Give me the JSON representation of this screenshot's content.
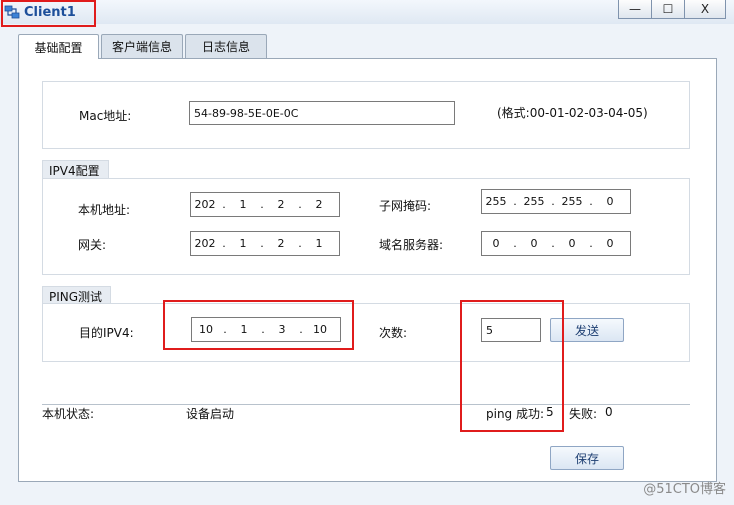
{
  "window": {
    "title": "Client1",
    "controls": {
      "minimize": "—",
      "maximize": "☐",
      "close": "X"
    }
  },
  "tabs": [
    {
      "label": "基础配置",
      "active": true
    },
    {
      "label": "客户端信息",
      "active": false
    },
    {
      "label": "日志信息",
      "active": false
    }
  ],
  "mac": {
    "label": "Mac地址:",
    "value": "54-89-98-5E-0E-0C",
    "format_hint": "(格式:00-01-02-03-04-05)"
  },
  "ipv4": {
    "legend": "IPV4配置",
    "local_ip_label": "本机地址:",
    "local_ip": [
      "202",
      "1",
      "2",
      "2"
    ],
    "subnet_label": "子网掩码:",
    "subnet": [
      "255",
      "255",
      "255",
      "0"
    ],
    "gateway_label": "网关:",
    "gateway": [
      "202",
      "1",
      "2",
      "1"
    ],
    "dns_label": "域名服务器:",
    "dns": [
      "0",
      "0",
      "0",
      "0"
    ]
  },
  "ping": {
    "legend": "PING测试",
    "target_label": "目的IPV4:",
    "target": [
      "10",
      "1",
      "3",
      "10"
    ],
    "count_label": "次数:",
    "count": "5",
    "send_label": "发送"
  },
  "status": {
    "label": "本机状态:",
    "value": "设备启动",
    "ping_success_label": "ping 成功:",
    "ping_success": "5",
    "fail_label": "失败:",
    "fail": "0"
  },
  "save_label": "保存",
  "watermark": "@51CTO博客",
  "colors": {
    "highlight": "#e01c1c",
    "title_text": "#1d4f9a"
  }
}
